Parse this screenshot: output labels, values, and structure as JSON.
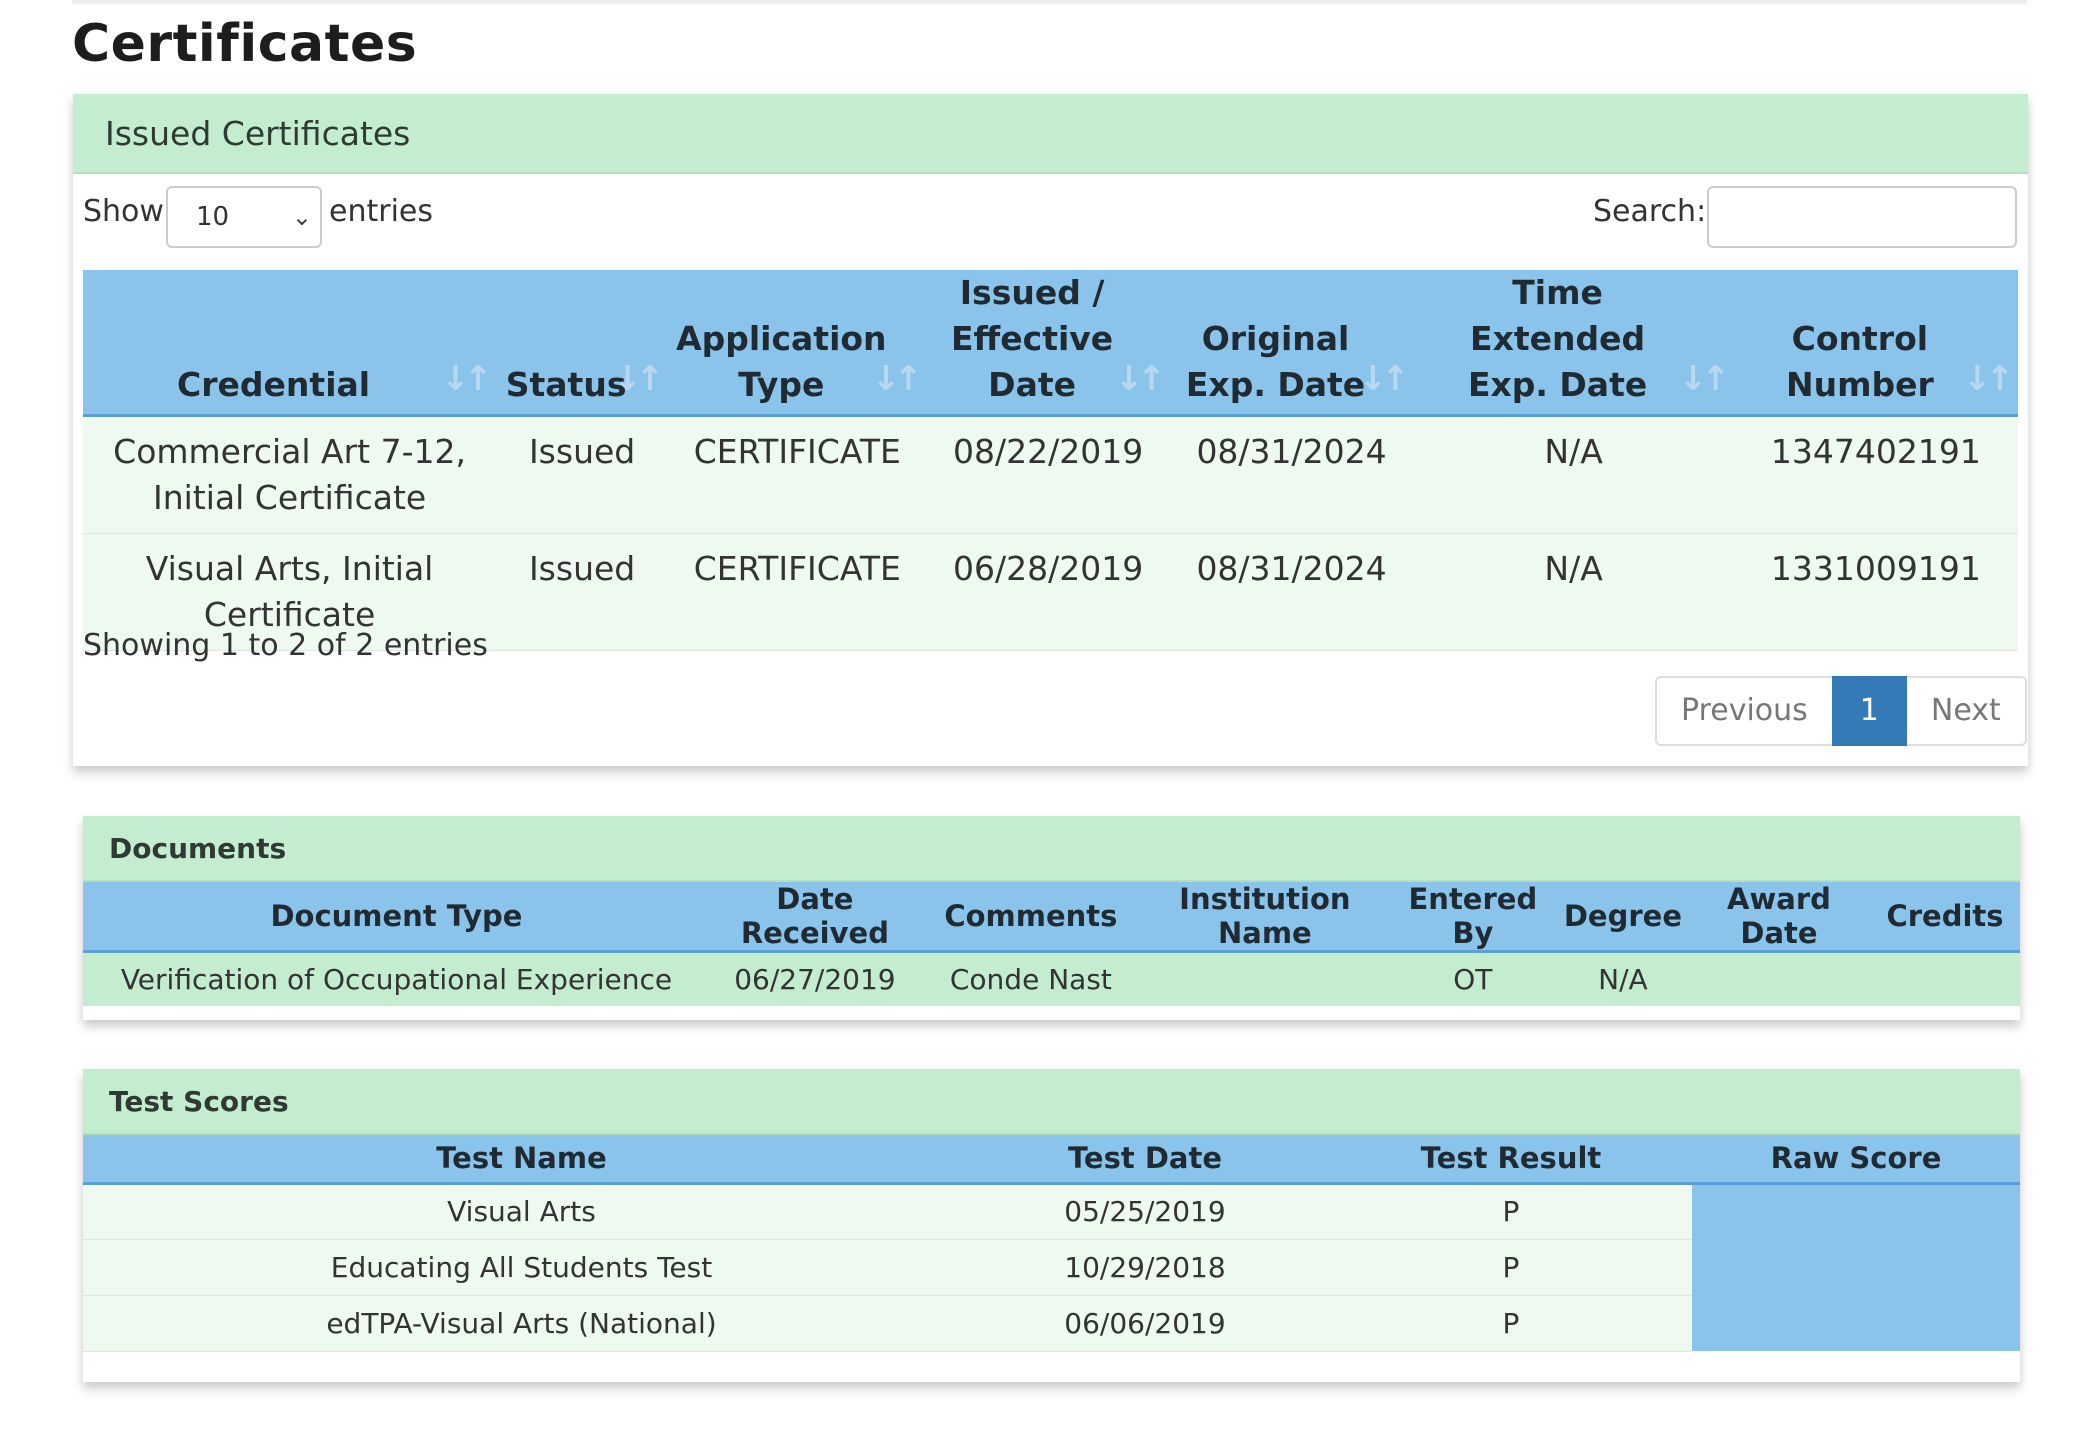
{
  "page": {
    "title": "Certificates"
  },
  "issued": {
    "heading": "Issued Certificates",
    "show_label": "Show",
    "entries_label": "entries",
    "length_value": "10",
    "search_label": "Search:",
    "search_value": "",
    "columns": [
      {
        "line1": "",
        "line2": "Credential"
      },
      {
        "line1": "",
        "line2": "Status"
      },
      {
        "line1": "Application",
        "line2": "Type"
      },
      {
        "line1": "Issued /",
        "line2": "Effective Date"
      },
      {
        "line1": "Original",
        "line2": "Exp. Date"
      },
      {
        "line1": "Time Extended",
        "line2": "Exp. Date"
      },
      {
        "line1": "Control",
        "line2": "Number"
      }
    ],
    "rows": [
      [
        "Commercial Art 7-12, Initial Certificate",
        "Issued",
        "CERTIFICATE",
        "08/22/2019",
        "08/31/2024",
        "N/A",
        "1347402191"
      ],
      [
        "Visual Arts, Initial Certificate",
        "Issued",
        "CERTIFICATE",
        "06/28/2019",
        "08/31/2024",
        "N/A",
        "1331009191"
      ]
    ],
    "info": "Showing 1 to 2 of 2 entries",
    "pagination": {
      "previous": "Previous",
      "current": "1",
      "next": "Next"
    }
  },
  "documents": {
    "heading": "Documents",
    "columns": [
      "Document Type",
      "Date Received",
      "Comments",
      "Institution Name",
      "Entered By",
      "Degree",
      "Award Date",
      "Credits"
    ],
    "rows": [
      [
        "Verification of Occupational Experience",
        "06/27/2019",
        "Conde Nast",
        "",
        "OT",
        "N/A",
        "",
        ""
      ]
    ]
  },
  "tests": {
    "heading": "Test Scores",
    "columns": [
      "Test Name",
      "Test Date",
      "Test Result",
      "Raw Score"
    ],
    "rows": [
      [
        "Visual Arts",
        "05/25/2019",
        "P",
        ""
      ],
      [
        "Educating All Students Test",
        "10/29/2018",
        "P",
        ""
      ],
      [
        "edTPA-Visual Arts (National)",
        "06/06/2019",
        "P",
        ""
      ]
    ]
  },
  "colors": {
    "header_green": "#c4ecce",
    "column_blue": "#8bc4ea",
    "row_green": "#eef9f0",
    "active_blue": "#337ab7"
  },
  "icons": {
    "sort": "sort-both-icon",
    "select": "chevron-down-icon"
  }
}
